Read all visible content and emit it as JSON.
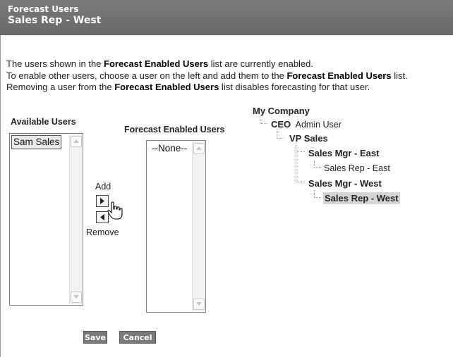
{
  "header": {
    "title": "Forecast Users",
    "subtitle": "Sales Rep - West"
  },
  "intro": {
    "line1_a": "The users shown in the ",
    "line1_b": "Forecast Enabled Users",
    "line1_c": " list are currently enabled.",
    "line2_a": "To enable other users, choose a user on the left and add them to the ",
    "line2_b": "Forecast Enabled Users",
    "line2_c": " list.",
    "line3_a": "Removing a user from the ",
    "line3_b": "Forecast Enabled Users",
    "line3_c": " list disables forecasting for that user."
  },
  "available": {
    "label": "Available Users",
    "items": [
      "Sam Sales"
    ]
  },
  "enabled": {
    "label": "Forecast Enabled Users",
    "items": [
      "--None--"
    ]
  },
  "mover": {
    "add_label": "Add",
    "remove_label": "Remove"
  },
  "tree": {
    "root": "My Company",
    "ceo_role": "CEO",
    "ceo_name": "Admin User",
    "vp": "VP Sales",
    "mgr_east": "Sales Mgr - East",
    "rep_east": "Sales Rep - East",
    "mgr_west": "Sales Mgr - West",
    "rep_west": "Sales Rep - West"
  },
  "actions": {
    "save": "Save",
    "cancel": "Cancel"
  }
}
